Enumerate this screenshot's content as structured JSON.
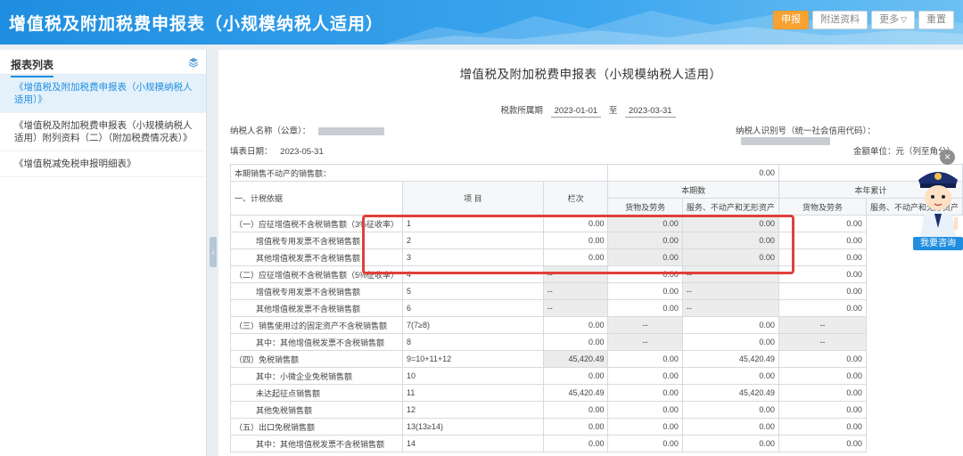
{
  "header": {
    "title": "增值税及附加税费申报表（小规模纳税人适用）",
    "buttons": {
      "declare": "申报",
      "attachments": "附送资料",
      "more": "更多",
      "reset": "重置"
    }
  },
  "sidebar": {
    "title": "报表列表",
    "items": [
      "《增值税及附加税费申报表（小规模纳税人适用）》",
      "《增值税及附加税费申报表（小规模纳税人适用）附列资料（二）（附加税费情况表）》",
      "《增值税减免税申报明细表》"
    ]
  },
  "form": {
    "title": "增值税及附加税费申报表（小规模纳税人适用）",
    "period_label": "税款所属期",
    "period_start": "2023-01-01",
    "period_to": "至",
    "period_end": "2023-03-31",
    "taxpayer_name_label": "纳税人名称（公章）：",
    "taxpayer_id_label": "纳税人识别号（统一社会信用代码）：",
    "fill_date_label": "填表日期：",
    "fill_date": "2023-05-31",
    "unit_label": "金额单位：元（列至角分）"
  },
  "table": {
    "top_row_label": "本期销售不动产的销售额：",
    "top_row_value": "0.00",
    "h_item": "项    目",
    "h_col": "栏次",
    "h_current": "本期数",
    "h_ytd": "本年累计",
    "h_goods": "货物及劳务",
    "h_services": "服务、不动产和无形资产",
    "section_label": "一、计税依据",
    "rows": [
      {
        "item": "（一）应征增值税不含税销售额（3%征收率）",
        "col": "1",
        "v": [
          "0.00",
          "0.00",
          "0.00",
          "0.00"
        ]
      },
      {
        "item": "增值税专用发票不含税销售额",
        "col": "2",
        "v": [
          "0.00",
          "0.00",
          "0.00",
          "0.00"
        ]
      },
      {
        "item": "其他增值税发票不含税销售额",
        "col": "3",
        "v": [
          "0.00",
          "0.00",
          "0.00",
          "0.00"
        ]
      },
      {
        "item": "（二）应征增值税不含税销售额（5%征收率）",
        "col": "4",
        "v": [
          "--",
          "0.00",
          "--",
          "0.00"
        ]
      },
      {
        "item": "增值税专用发票不含税销售额",
        "col": "5",
        "v": [
          "--",
          "0.00",
          "--",
          "0.00"
        ]
      },
      {
        "item": "其他增值税发票不含税销售额",
        "col": "6",
        "v": [
          "--",
          "0.00",
          "--",
          "0.00"
        ]
      },
      {
        "item": "（三）销售使用过的固定资产不含税销售额",
        "col": "7(7≥8)",
        "v": [
          "0.00",
          "--",
          "0.00",
          "--"
        ]
      },
      {
        "item": "其中：其他增值税发票不含税销售额",
        "col": "8",
        "v": [
          "0.00",
          "--",
          "0.00",
          "--"
        ]
      },
      {
        "item": "（四）免税销售额",
        "col": "9=10+11+12",
        "v": [
          "45,420.49",
          "0.00",
          "45,420.49",
          "0.00"
        ]
      },
      {
        "item": "其中：小微企业免税销售额",
        "col": "10",
        "v": [
          "0.00",
          "0.00",
          "0.00",
          "0.00"
        ]
      },
      {
        "item": "未达起征点销售额",
        "col": "11",
        "v": [
          "45,420.49",
          "0.00",
          "45,420.49",
          "0.00"
        ]
      },
      {
        "item": "其他免税销售额",
        "col": "12",
        "v": [
          "0.00",
          "0.00",
          "0.00",
          "0.00"
        ]
      },
      {
        "item": "（五）出口免税销售额",
        "col": "13(13≥14)",
        "v": [
          "0.00",
          "0.00",
          "0.00",
          "0.00"
        ]
      },
      {
        "item": "其中：其他增值税发票不含税销售额",
        "col": "14",
        "v": [
          "0.00",
          "0.00",
          "0.00",
          "0.00"
        ]
      }
    ]
  },
  "assistant": {
    "close": "×",
    "consult": "我要咨询"
  }
}
